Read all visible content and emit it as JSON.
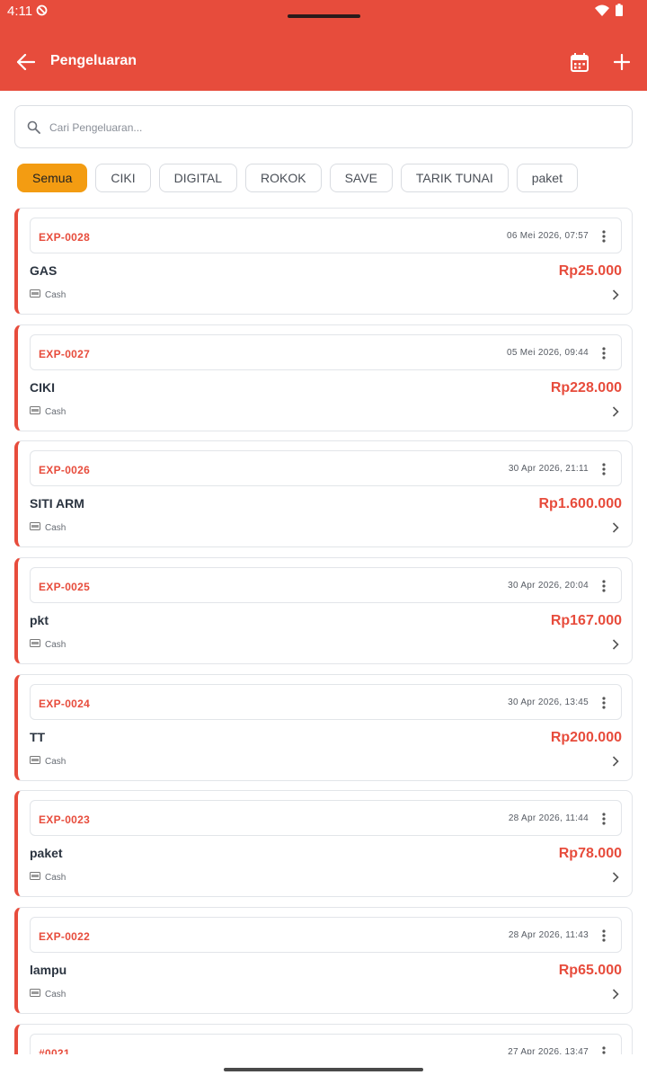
{
  "status_bar": {
    "time": "4:11"
  },
  "app_bar": {
    "title": "Pengeluaran"
  },
  "search": {
    "placeholder": "Cari Pengeluaran..."
  },
  "filters": [
    "Semua",
    "CIKI",
    "DIGITAL",
    "ROKOK",
    "SAVE",
    "TARIK TUNAI",
    "paket"
  ],
  "active_filter": "Semua",
  "expenses": [
    {
      "code": "EXP-0028",
      "date": "06 Mei 2026, 07:57",
      "name": "GAS",
      "amount": "Rp25.000",
      "payment": "Cash"
    },
    {
      "code": "EXP-0027",
      "date": "05 Mei 2026, 09:44",
      "name": "CIKI",
      "amount": "Rp228.000",
      "payment": "Cash"
    },
    {
      "code": "EXP-0026",
      "date": "30 Apr 2026, 21:11",
      "name": "SITI ARM",
      "amount": "Rp1.600.000",
      "payment": "Cash"
    },
    {
      "code": "EXP-0025",
      "date": "30 Apr 2026, 20:04",
      "name": "pkt",
      "amount": "Rp167.000",
      "payment": "Cash"
    },
    {
      "code": "EXP-0024",
      "date": "30 Apr 2026, 13:45",
      "name": "TT",
      "amount": "Rp200.000",
      "payment": "Cash"
    },
    {
      "code": "EXP-0023",
      "date": "28 Apr 2026, 11:44",
      "name": "paket",
      "amount": "Rp78.000",
      "payment": "Cash"
    },
    {
      "code": "EXP-0022",
      "date": "28 Apr 2026, 11:43",
      "name": "lampu",
      "amount": "Rp65.000",
      "payment": "Cash"
    },
    {
      "code": "#0021",
      "date": "27 Apr 2026, 13:47",
      "name": "",
      "amount": "",
      "payment": ""
    }
  ],
  "colors": {
    "primary": "#e74c3c",
    "chip_active": "#f39c12"
  },
  "icons": [
    "back-arrow-icon",
    "calendar-icon",
    "plus-icon",
    "search-icon",
    "more-vert-icon",
    "cash-icon",
    "chevron-right-icon"
  ]
}
